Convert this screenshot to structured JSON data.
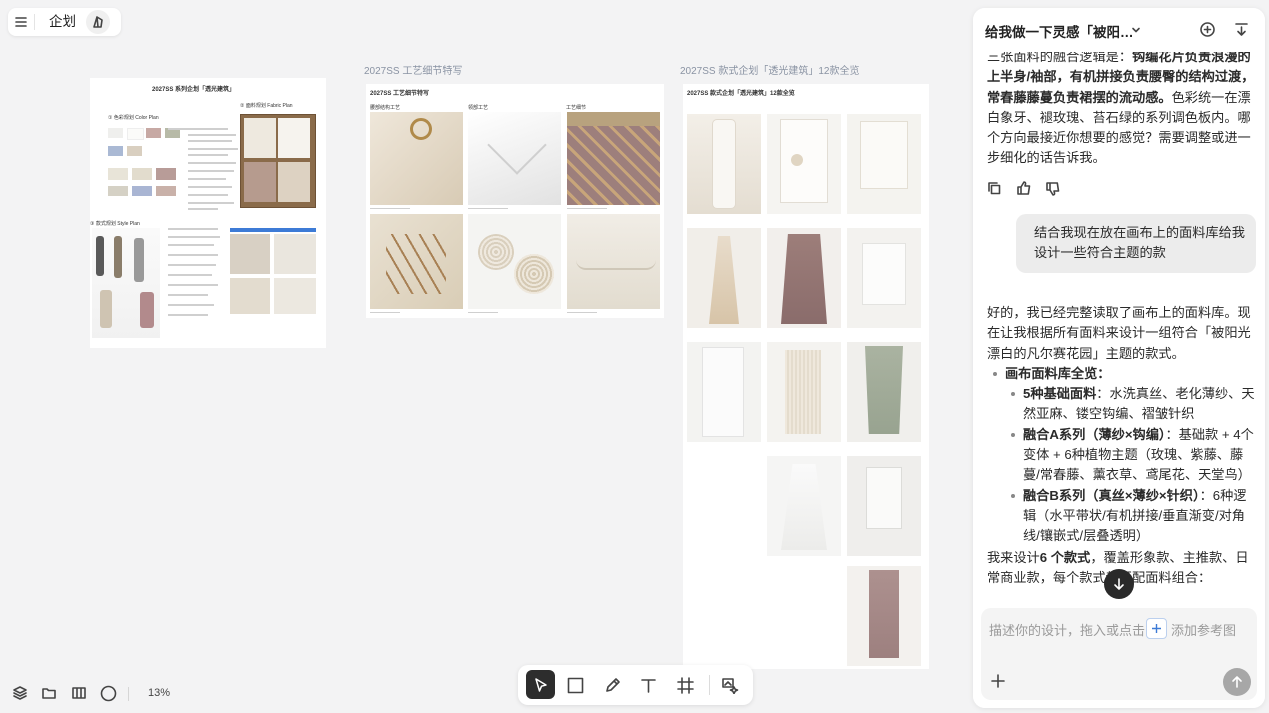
{
  "topbar": {
    "menu_icon": "menu-icon",
    "project_name": "企划",
    "brand_icon": "bag-icon"
  },
  "canvas": {
    "labels": {
      "craft": "2027SS 工艺细节特写",
      "style": "2027SS 款式企划「透光建筑」12款全览"
    },
    "board1": {
      "title": "2027SS 系列企划「透光建筑」",
      "color_plan": "① 色彩规划 Color Plan",
      "fabric_plan": "② 面料规划 Fabric Plan",
      "style_plan": "③ 款式规划 Style Plan"
    },
    "board2": {
      "title": "2027SS 工艺细节特写",
      "cap1": "腰部结构工艺",
      "cap2": "领部工艺",
      "cap3": "工艺细节"
    },
    "board3": {
      "title": "2027SS 款式企划「透光建筑」12款全览"
    }
  },
  "bottom_left": {
    "zoom": "13%"
  },
  "panel": {
    "title": "给我做一下灵感「被阳…",
    "msg1_line1": "三张面料的融合逻辑是：",
    "msg1_bold": "钩编花片负责浪漫的上半身/袖部，有机拼接负责腰臀的结构过渡，常春藤藤蔓负责裙摆的流动感。",
    "msg1_rest": "色彩统一在漂白象牙、褪玫瑰、苔石绿的系列调色板内。哪个方向最接近你想要的感觉？需要调整或进一步细化的话告诉我。",
    "user_msg": "结合我现在放在画布上的面料库给我设计一些符合主题的款",
    "reply_intro": "好的，我已经完整读取了画布上的面料库。现在让我根据所有面料来设计一组符合「被阳光漂白的凡尔赛花园」主题的款式。",
    "bullet_head": "画布面料库全览：",
    "sub1_bold": "5种基础面料",
    "sub1_text": "：水洗真丝、老化薄纱、天然亚麻、镂空钩编、褶皱针织",
    "sub2_bold": "融合A系列（薄纱×钩编）",
    "sub2_text": "：基础款 + 4个变体 + 6种植物主题（玫瑰、紫藤、藤蔓/常春藤、薰衣草、鸢尾花、天堂鸟）",
    "sub3_bold": "融合B系列（真丝×薄纱×针织）",
    "sub3_text": "：6种逻辑（水平带状/有机拼接/垂直渐变/对角线/镶嵌式/层叠透明）",
    "closing_pre": "我来设计",
    "closing_bold": "6 个款式",
    "closing_post": "，覆盖形象款、主推款、日常商业款，每个款式都匹配面料组合：",
    "input_placeholder": "描述你的设计，拖入或点击",
    "input_ref": "添加参考图"
  },
  "colors": {
    "accent_blue": "#3d7bd6",
    "send_button": "#a7a7a7",
    "tool_active": "#2d2d2d"
  }
}
